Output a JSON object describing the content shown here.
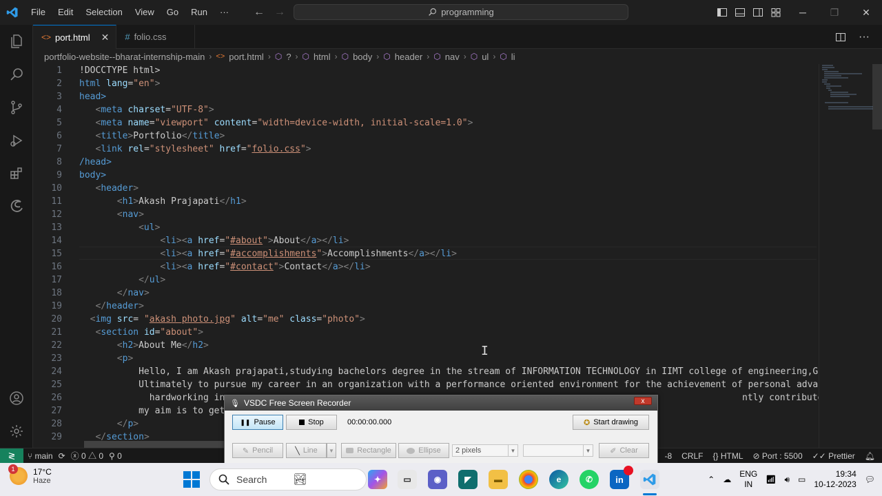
{
  "titlebar": {
    "menus": [
      "File",
      "Edit",
      "Selection",
      "View",
      "Go",
      "Run",
      "···"
    ],
    "search": "programming"
  },
  "tabs": [
    {
      "label": "port.html",
      "active": true
    },
    {
      "label": "folio.css",
      "active": false
    }
  ],
  "breadcrumb": [
    "portfolio-website--bharat-internship-main",
    "port.html",
    "?",
    "html",
    "body",
    "header",
    "nav",
    "ul",
    "li"
  ],
  "editor": {
    "line_numbers": [
      "1",
      "2",
      "3",
      "4",
      "5",
      "6",
      "7",
      "8",
      "9",
      "10",
      "11",
      "12",
      "13",
      "14",
      "15",
      "16",
      "17",
      "18",
      "19",
      "20",
      "21",
      "22",
      "23",
      "24",
      "25",
      "26",
      "27",
      "28",
      "29"
    ],
    "code": {
      "l1": "!DOCCTYPE html>",
      "l2_tag": "html",
      "l2_attr": "lang",
      "l2_val": "\"en\"",
      "l3": "head>",
      "l4_attr": "charset",
      "l4_val": "\"UTF-8\"",
      "l5_attr1": "name",
      "l5_val1": "\"viewport\"",
      "l5_attr2": "content",
      "l5_val2": "\"width=device-width, initial-scale=1.0\"",
      "l6_text": "Portfolio",
      "l7_attr1": "rel",
      "l7_val1": "\"stylesheet\"",
      "l7_attr2": "href",
      "l7_val2q": "\"",
      "l7_val2": "folio.css",
      "l7_val2q2": "\"",
      "l8": "/head>",
      "l9": "body>",
      "l11_text": "Akash Prajapati",
      "l14_href": "#about",
      "l14_text": "About",
      "l15_href": "#accomplishments",
      "l15_text": "Accomplishments",
      "l16_href": "#contact",
      "l16_text": "Contact",
      "l20_src": "akash photo.jpg",
      "l20_alt": "\"me\"",
      "l20_class": "\"photo\"",
      "l21_id": "\"about\"",
      "l22_text": "About Me",
      "l24": "Hello, I am Akash prajapati,studying bachelors degree in the stream of INFORMATION TECHNOLOGY in IIMT college of engineering,Gre",
      "l25": "Ultimately to pursue my career in an organization with a performance oriented environment for the achievement of personal advanc",
      "l26a": "  hardworking in",
      "l26b": "ntly contribute my skills as a",
      "l27": "my aim is to get"
    }
  },
  "statusbar": {
    "branch": "main",
    "errors": "0",
    "warnings": "0",
    "ports": "0",
    "encoding_tail": "-8",
    "eol": "CRLF",
    "language": "HTML",
    "port": "Port : 5500",
    "formatter": "Prettier"
  },
  "vsdc": {
    "title": "VSDC Free Screen Recorder",
    "close": "x",
    "pause": "Pause",
    "stop": "Stop",
    "timer": "00:00:00.000",
    "start_drawing": "Start drawing",
    "pencil": "Pencil",
    "line": "Line",
    "rectangle": "Rectangle",
    "ellipse": "Ellipse",
    "pixels": "2 pixels",
    "clear": "Clear"
  },
  "taskbar": {
    "weather_badge": "1",
    "temp": "17°C",
    "condition": "Haze",
    "search": "Search",
    "lang1": "ENG",
    "lang2": "IN",
    "time": "19:34",
    "date": "10-12-2023"
  },
  "colors": {
    "accent": "#0078d4",
    "tag": "#569cd6",
    "attr": "#9cdcfe",
    "string": "#ce9178",
    "remote": "#16825d"
  }
}
